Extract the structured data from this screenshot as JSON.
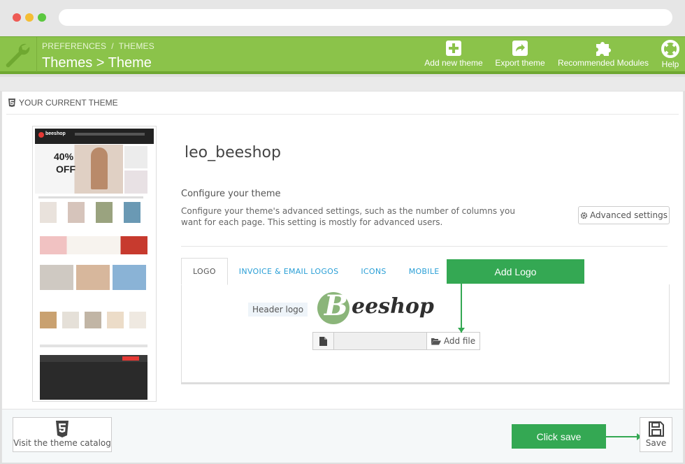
{
  "toolbar": {
    "breadcrumb": [
      "PREFERENCES",
      "THEMES"
    ],
    "breadcrumb_sep": "/",
    "title": "Themes > Theme",
    "buttons": [
      {
        "label": "Add new theme",
        "icon": "plus-square-icon"
      },
      {
        "label": "Export theme",
        "icon": "share-icon"
      },
      {
        "label": "Recommended Modules",
        "icon": "puzzle-icon"
      },
      {
        "label": "Help",
        "icon": "lifebuoy-icon"
      }
    ],
    "color": "#8bc34a"
  },
  "panel": {
    "heading": "YOUR CURRENT THEME",
    "theme_name": "leo_beeshop",
    "configure_title": "Configure your theme",
    "configure_text": "Configure your theme's advanced settings, such as the number of columns you want for each page. This setting is mostly for advanced users.",
    "advanced_button": "Advanced settings",
    "tabs": [
      "LOGO",
      "INVOICE & EMAIL LOGOS",
      "ICONS",
      "MOBILE"
    ],
    "active_tab": "LOGO",
    "header_logo_label": "Header logo",
    "logo_letter": "B",
    "logo_text": "eeshop",
    "add_file_button": "Add file"
  },
  "preview": {
    "logo_text": "beeshop",
    "banner_percent": "40%",
    "banner_off": "OFF"
  },
  "callouts": {
    "add_logo": "Add Logo",
    "click_save": "Click save",
    "color": "#34a853"
  },
  "footer": {
    "catalog_button": "Visit the theme catalog",
    "save_button": "Save"
  }
}
